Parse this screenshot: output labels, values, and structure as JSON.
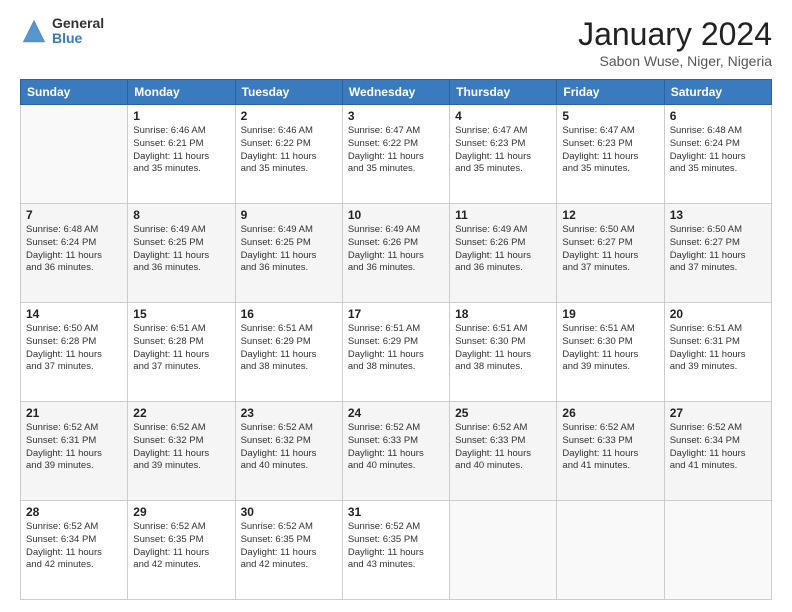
{
  "header": {
    "logo_general": "General",
    "logo_blue": "Blue",
    "month_title": "January 2024",
    "location": "Sabon Wuse, Niger, Nigeria"
  },
  "days_of_week": [
    "Sunday",
    "Monday",
    "Tuesday",
    "Wednesday",
    "Thursday",
    "Friday",
    "Saturday"
  ],
  "weeks": [
    [
      {
        "day": "",
        "info": ""
      },
      {
        "day": "1",
        "info": "Sunrise: 6:46 AM\nSunset: 6:21 PM\nDaylight: 11 hours\nand 35 minutes."
      },
      {
        "day": "2",
        "info": "Sunrise: 6:46 AM\nSunset: 6:22 PM\nDaylight: 11 hours\nand 35 minutes."
      },
      {
        "day": "3",
        "info": "Sunrise: 6:47 AM\nSunset: 6:22 PM\nDaylight: 11 hours\nand 35 minutes."
      },
      {
        "day": "4",
        "info": "Sunrise: 6:47 AM\nSunset: 6:23 PM\nDaylight: 11 hours\nand 35 minutes."
      },
      {
        "day": "5",
        "info": "Sunrise: 6:47 AM\nSunset: 6:23 PM\nDaylight: 11 hours\nand 35 minutes."
      },
      {
        "day": "6",
        "info": "Sunrise: 6:48 AM\nSunset: 6:24 PM\nDaylight: 11 hours\nand 35 minutes."
      }
    ],
    [
      {
        "day": "7",
        "info": "Sunrise: 6:48 AM\nSunset: 6:24 PM\nDaylight: 11 hours\nand 36 minutes."
      },
      {
        "day": "8",
        "info": "Sunrise: 6:49 AM\nSunset: 6:25 PM\nDaylight: 11 hours\nand 36 minutes."
      },
      {
        "day": "9",
        "info": "Sunrise: 6:49 AM\nSunset: 6:25 PM\nDaylight: 11 hours\nand 36 minutes."
      },
      {
        "day": "10",
        "info": "Sunrise: 6:49 AM\nSunset: 6:26 PM\nDaylight: 11 hours\nand 36 minutes."
      },
      {
        "day": "11",
        "info": "Sunrise: 6:49 AM\nSunset: 6:26 PM\nDaylight: 11 hours\nand 36 minutes."
      },
      {
        "day": "12",
        "info": "Sunrise: 6:50 AM\nSunset: 6:27 PM\nDaylight: 11 hours\nand 37 minutes."
      },
      {
        "day": "13",
        "info": "Sunrise: 6:50 AM\nSunset: 6:27 PM\nDaylight: 11 hours\nand 37 minutes."
      }
    ],
    [
      {
        "day": "14",
        "info": "Sunrise: 6:50 AM\nSunset: 6:28 PM\nDaylight: 11 hours\nand 37 minutes."
      },
      {
        "day": "15",
        "info": "Sunrise: 6:51 AM\nSunset: 6:28 PM\nDaylight: 11 hours\nand 37 minutes."
      },
      {
        "day": "16",
        "info": "Sunrise: 6:51 AM\nSunset: 6:29 PM\nDaylight: 11 hours\nand 38 minutes."
      },
      {
        "day": "17",
        "info": "Sunrise: 6:51 AM\nSunset: 6:29 PM\nDaylight: 11 hours\nand 38 minutes."
      },
      {
        "day": "18",
        "info": "Sunrise: 6:51 AM\nSunset: 6:30 PM\nDaylight: 11 hours\nand 38 minutes."
      },
      {
        "day": "19",
        "info": "Sunrise: 6:51 AM\nSunset: 6:30 PM\nDaylight: 11 hours\nand 39 minutes."
      },
      {
        "day": "20",
        "info": "Sunrise: 6:51 AM\nSunset: 6:31 PM\nDaylight: 11 hours\nand 39 minutes."
      }
    ],
    [
      {
        "day": "21",
        "info": "Sunrise: 6:52 AM\nSunset: 6:31 PM\nDaylight: 11 hours\nand 39 minutes."
      },
      {
        "day": "22",
        "info": "Sunrise: 6:52 AM\nSunset: 6:32 PM\nDaylight: 11 hours\nand 39 minutes."
      },
      {
        "day": "23",
        "info": "Sunrise: 6:52 AM\nSunset: 6:32 PM\nDaylight: 11 hours\nand 40 minutes."
      },
      {
        "day": "24",
        "info": "Sunrise: 6:52 AM\nSunset: 6:33 PM\nDaylight: 11 hours\nand 40 minutes."
      },
      {
        "day": "25",
        "info": "Sunrise: 6:52 AM\nSunset: 6:33 PM\nDaylight: 11 hours\nand 40 minutes."
      },
      {
        "day": "26",
        "info": "Sunrise: 6:52 AM\nSunset: 6:33 PM\nDaylight: 11 hours\nand 41 minutes."
      },
      {
        "day": "27",
        "info": "Sunrise: 6:52 AM\nSunset: 6:34 PM\nDaylight: 11 hours\nand 41 minutes."
      }
    ],
    [
      {
        "day": "28",
        "info": "Sunrise: 6:52 AM\nSunset: 6:34 PM\nDaylight: 11 hours\nand 42 minutes."
      },
      {
        "day": "29",
        "info": "Sunrise: 6:52 AM\nSunset: 6:35 PM\nDaylight: 11 hours\nand 42 minutes."
      },
      {
        "day": "30",
        "info": "Sunrise: 6:52 AM\nSunset: 6:35 PM\nDaylight: 11 hours\nand 42 minutes."
      },
      {
        "day": "31",
        "info": "Sunrise: 6:52 AM\nSunset: 6:35 PM\nDaylight: 11 hours\nand 43 minutes."
      },
      {
        "day": "",
        "info": ""
      },
      {
        "day": "",
        "info": ""
      },
      {
        "day": "",
        "info": ""
      }
    ]
  ]
}
